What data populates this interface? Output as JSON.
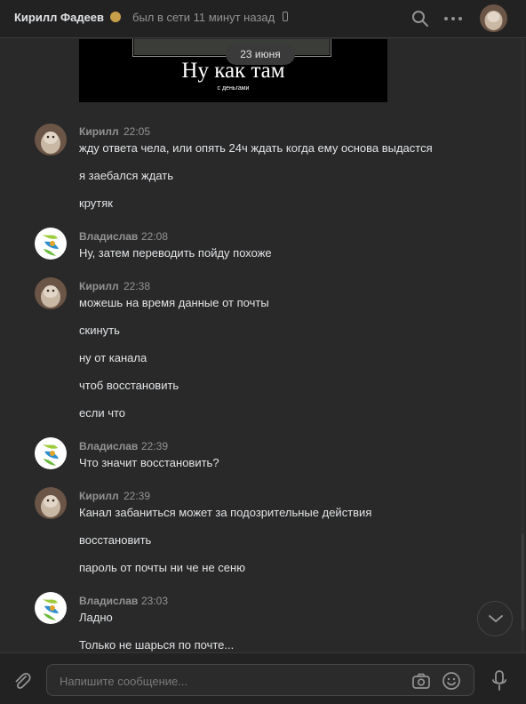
{
  "header": {
    "contact_name": "Кирилл Фадеев",
    "status": "был в сети 11 минут назад",
    "icons": [
      "search-icon",
      "more-icon",
      "phone-icon",
      "crown-icon"
    ]
  },
  "attachment": {
    "title": "Ну как там",
    "subtitle": "с деньгами"
  },
  "date_divider": "23 июня",
  "messages": [
    {
      "author": "Кирилл",
      "time": "22:05",
      "lines": [
        "жду ответа чела, или опять 24ч ждать когда ему основа выдастся",
        "я заебался ждать",
        "крутяк"
      ]
    },
    {
      "author": "Владислав",
      "time": "22:08",
      "lines": [
        "Ну, затем переводить пойду похоже"
      ]
    },
    {
      "author": "Кирилл",
      "time": "22:38",
      "lines": [
        "можешь на время данные от почты",
        "скинуть",
        "ну от канала",
        "чтоб восстановить",
        "если что"
      ]
    },
    {
      "author": "Владислав",
      "time": "22:39",
      "lines": [
        "Что значит восстановить?"
      ]
    },
    {
      "author": "Кирилл",
      "time": "22:39",
      "lines": [
        "Канал забаниться может за подозрительные действия",
        "восстановить",
        "пароль от почты ни че не сеню"
      ]
    },
    {
      "author": "Владислав",
      "time": "23:03",
      "lines": [
        "Ладно",
        "Только не шарься по почте..."
      ]
    }
  ],
  "composer": {
    "placeholder": "Напишите сообщение..."
  },
  "colors": {
    "background": "#292929",
    "header": "#222222",
    "text": "#e1e3e6",
    "secondary": "#939393"
  }
}
